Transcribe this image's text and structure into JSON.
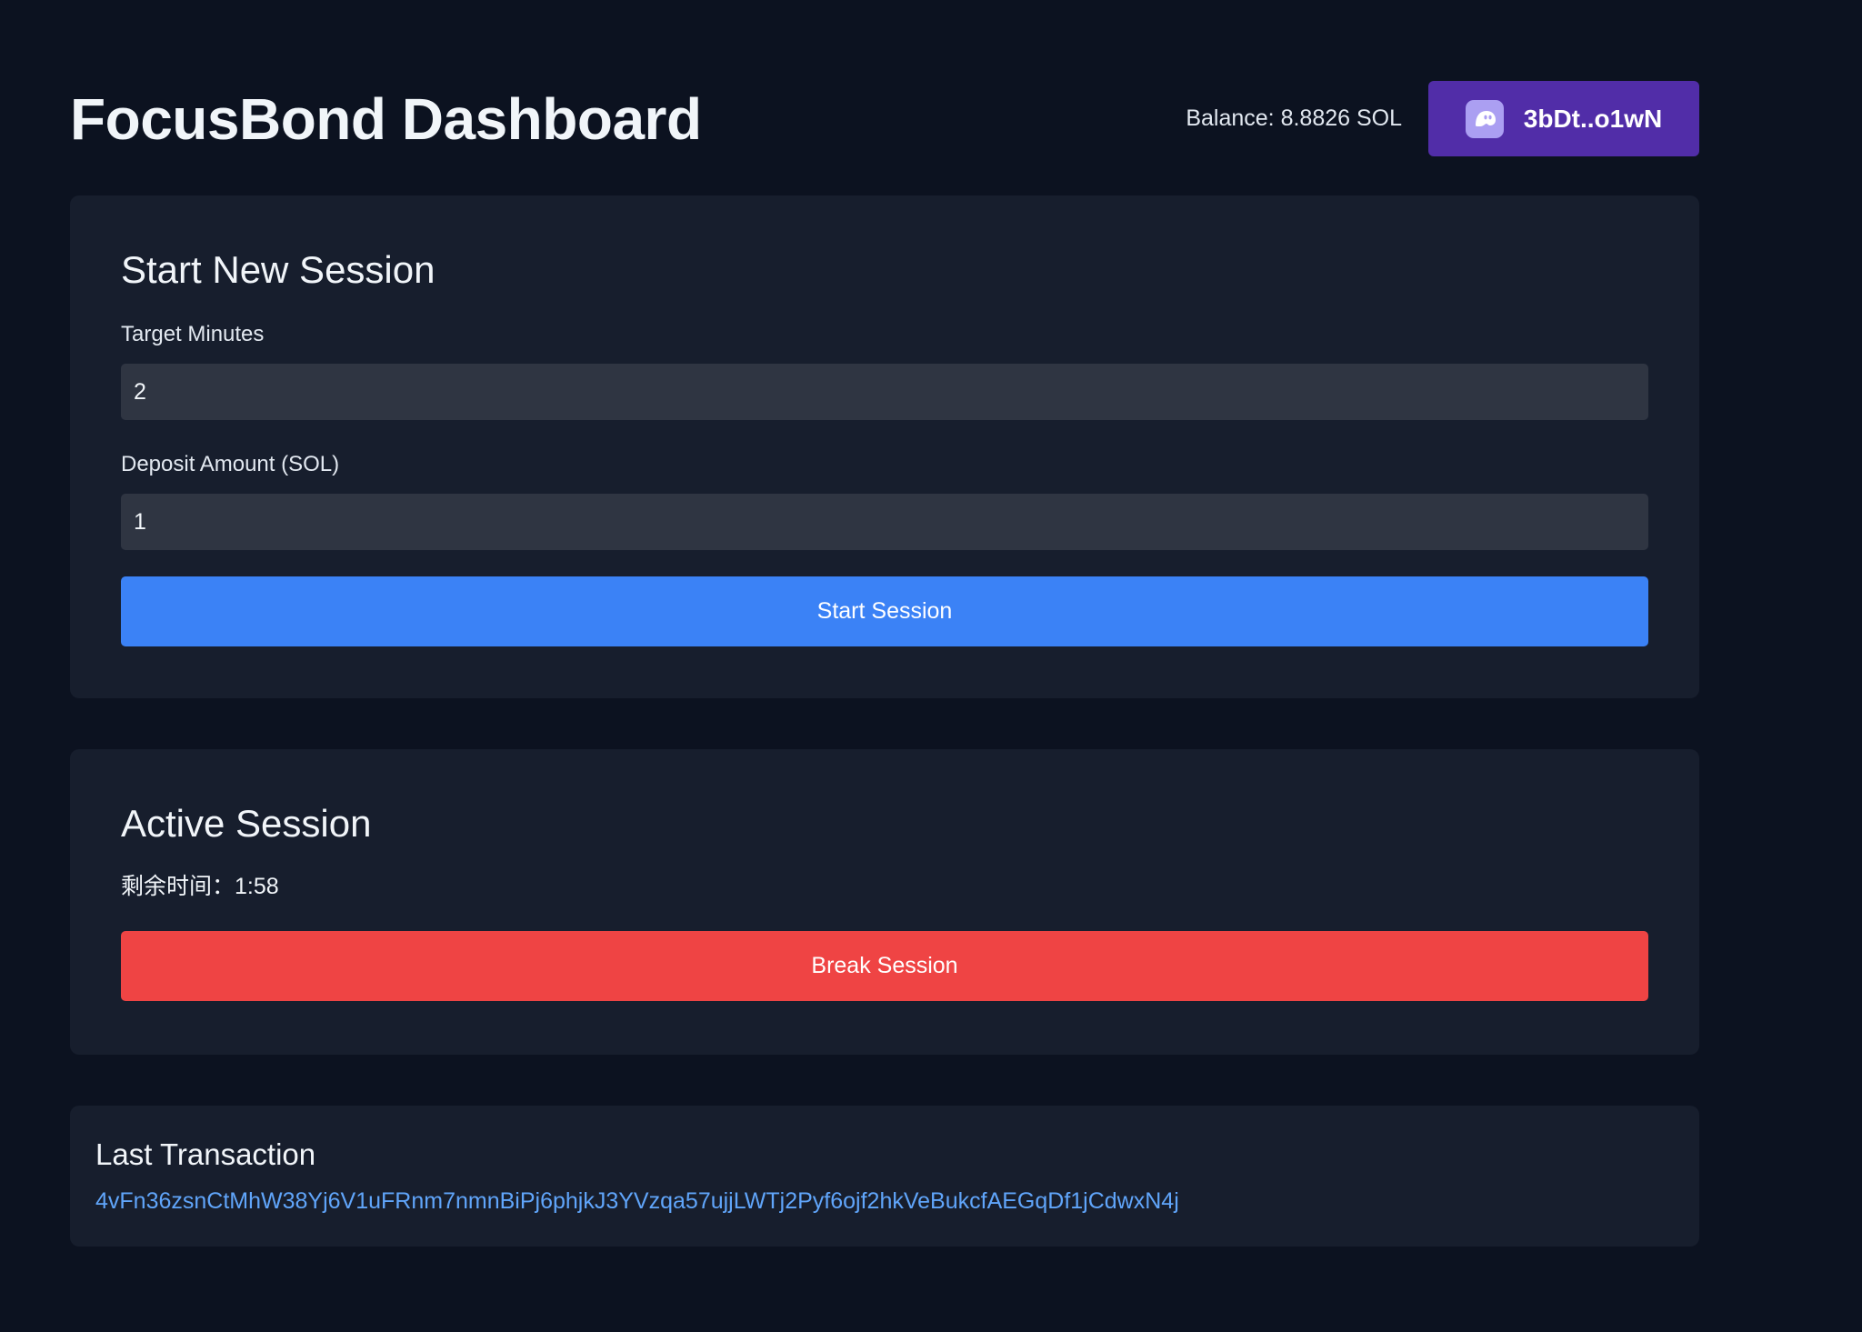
{
  "header": {
    "title": "FocusBond Dashboard",
    "balance": "Balance: 8.8826 SOL",
    "wallet_address": "3bDt..o1wN",
    "wallet_icon": "phantom-ghost-icon"
  },
  "start_session": {
    "heading": "Start New Session",
    "target_minutes_label": "Target Minutes",
    "target_minutes_value": "2",
    "deposit_label": "Deposit Amount (SOL)",
    "deposit_value": "1",
    "start_button_label": "Start Session"
  },
  "active_session": {
    "heading": "Active Session",
    "remaining_time": "剩余时间：1:58",
    "break_button_label": "Break Session"
  },
  "last_transaction": {
    "heading": "Last Transaction",
    "signature": "4vFn36zsnCtMhW38Yj6V1uFRnm7nmnBiPj6phjkJ3YVzqa57ujjLWTj2Pyf6ojf2hkVeBukcfAEGqDf1jCdwxN4j"
  },
  "colors": {
    "background": "#0c1220",
    "card": "#171e2d",
    "input": "#2f3542",
    "wallet_button": "#512da8",
    "start_button": "#3b82f6",
    "break_button": "#ef4444",
    "link": "#60a5fa"
  }
}
